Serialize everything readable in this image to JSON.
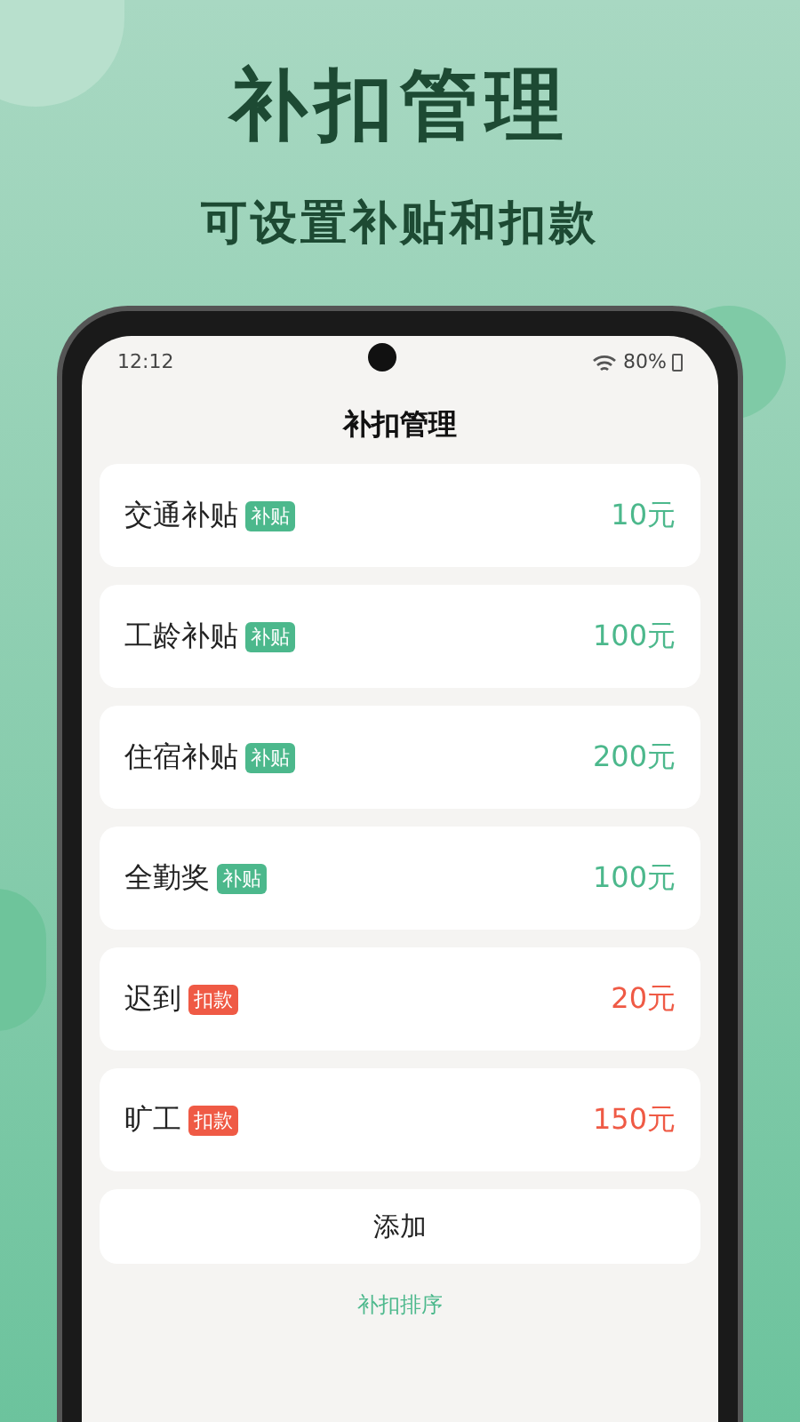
{
  "promo": {
    "title": "补扣管理",
    "subtitle": "可设置补贴和扣款"
  },
  "status_bar": {
    "time": "12:12",
    "battery": "80%"
  },
  "header": {
    "title": "补扣管理"
  },
  "items": [
    {
      "name": "交通补贴",
      "kind": "allowance",
      "tag": "补贴",
      "amount": "10元"
    },
    {
      "name": "工龄补贴",
      "kind": "allowance",
      "tag": "补贴",
      "amount": "100元"
    },
    {
      "name": "住宿补贴",
      "kind": "allowance",
      "tag": "补贴",
      "amount": "200元"
    },
    {
      "name": "全勤奖",
      "kind": "allowance",
      "tag": "补贴",
      "amount": "100元"
    },
    {
      "name": "迟到",
      "kind": "deduction",
      "tag": "扣款",
      "amount": "20元"
    },
    {
      "name": "旷工",
      "kind": "deduction",
      "tag": "扣款",
      "amount": "150元"
    }
  ],
  "add_button": "添加",
  "sort_link": "补扣排序"
}
